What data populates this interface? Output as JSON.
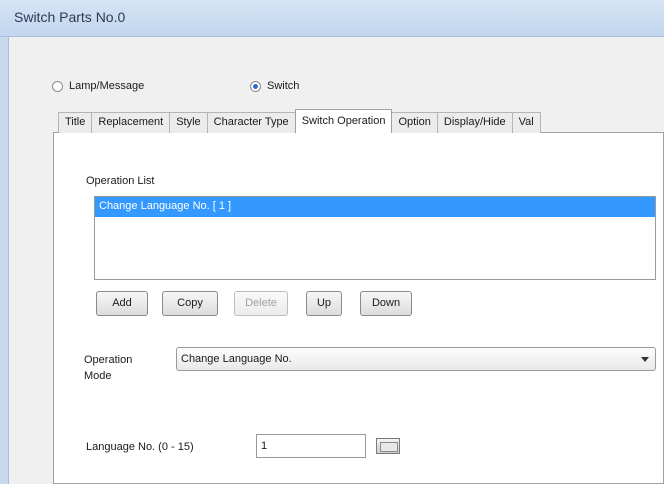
{
  "window": {
    "title": "Switch Parts No.0"
  },
  "mode": {
    "options": [
      {
        "label": "Lamp/Message",
        "selected": false
      },
      {
        "label": "Switch",
        "selected": true
      }
    ]
  },
  "tabs": [
    {
      "label": "Title",
      "active": false
    },
    {
      "label": "Replacement",
      "active": false
    },
    {
      "label": "Style",
      "active": false
    },
    {
      "label": "Character Type",
      "active": false
    },
    {
      "label": "Switch Operation",
      "active": true
    },
    {
      "label": "Option",
      "active": false
    },
    {
      "label": "Display/Hide",
      "active": false
    },
    {
      "label": "Val",
      "active": false
    }
  ],
  "operation_list": {
    "label": "Operation List",
    "items": [
      "Change Language No. [ 1 ]"
    ],
    "selected_index": 0
  },
  "buttons": {
    "add": "Add",
    "copy": "Copy",
    "delete": "Delete",
    "up": "Up",
    "down": "Down"
  },
  "operation_mode": {
    "label_line1": "Operation",
    "label_line2": "Mode",
    "value": "Change Language No."
  },
  "language": {
    "label": "Language No. (0 - 15)",
    "value": "1"
  }
}
